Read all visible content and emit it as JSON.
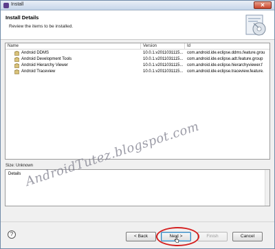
{
  "window": {
    "title": "Install"
  },
  "header": {
    "title": "Install Details",
    "subtitle": "Review the items to be installed."
  },
  "table": {
    "columns": [
      "Name",
      "Version",
      "Id"
    ],
    "rows": [
      {
        "name": "Android DDMS",
        "version": "10.0.1.v2011031115...",
        "id": "com.android.ide.eclipse.ddms.feature.grou"
      },
      {
        "name": "Android Development Tools",
        "version": "10.0.1.v2011031115...",
        "id": "com.android.ide.eclipse.adt.feature.group"
      },
      {
        "name": "Android Hierarchy Viewer",
        "version": "10.0.1.v2011031115...",
        "id": "com.android.ide.eclipse.hierarchyviewer.f"
      },
      {
        "name": "Android Traceview",
        "version": "10.0.1.v2011031115...",
        "id": "com.android.ide.eclipse.traceview.feature."
      }
    ]
  },
  "size_label": "Size: Unknown",
  "details_label": "Details",
  "watermark": "AndroidTutez.blogspot.com",
  "buttons": {
    "back": "< Back",
    "next": "Next >",
    "finish": "Finish",
    "cancel": "Cancel",
    "help": "?"
  },
  "colors": {
    "highlight": "#d41f1f",
    "accent": "#3c7fb1"
  }
}
